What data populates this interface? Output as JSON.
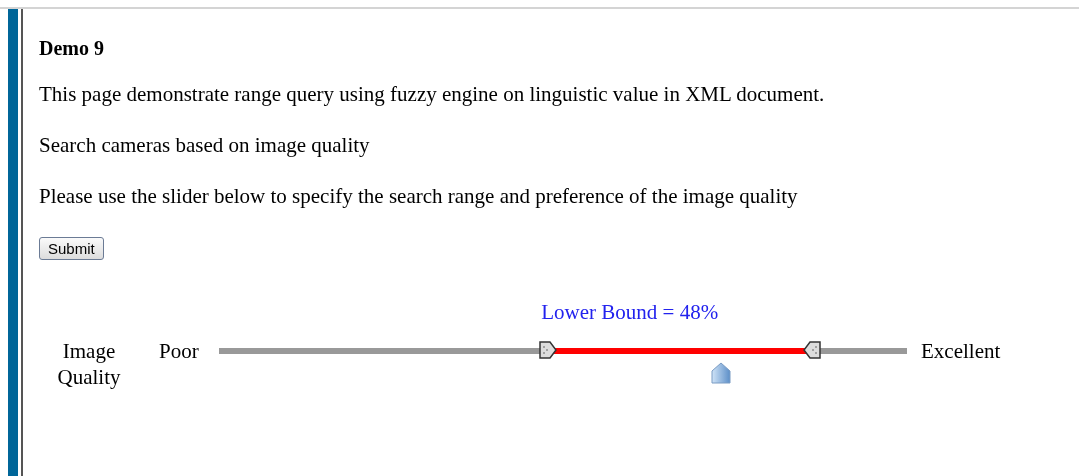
{
  "heading": "Demo 9",
  "paragraphs": [
    "This page demonstrate range query using fuzzy engine on linguistic value in XML document.",
    "Search cameras based on image quality",
    "Please use the slider below to specify the search range and preference of the image quality"
  ],
  "submit_button": "Submit",
  "slider": {
    "label": "Image Quality",
    "min_label": "Poor",
    "max_label": "Excellent",
    "readout": "Lower Bound = 48%",
    "lower": {
      "level": 0.48
    },
    "upper": {
      "level": 0.86
    },
    "preference": {
      "level": 0.73
    }
  }
}
